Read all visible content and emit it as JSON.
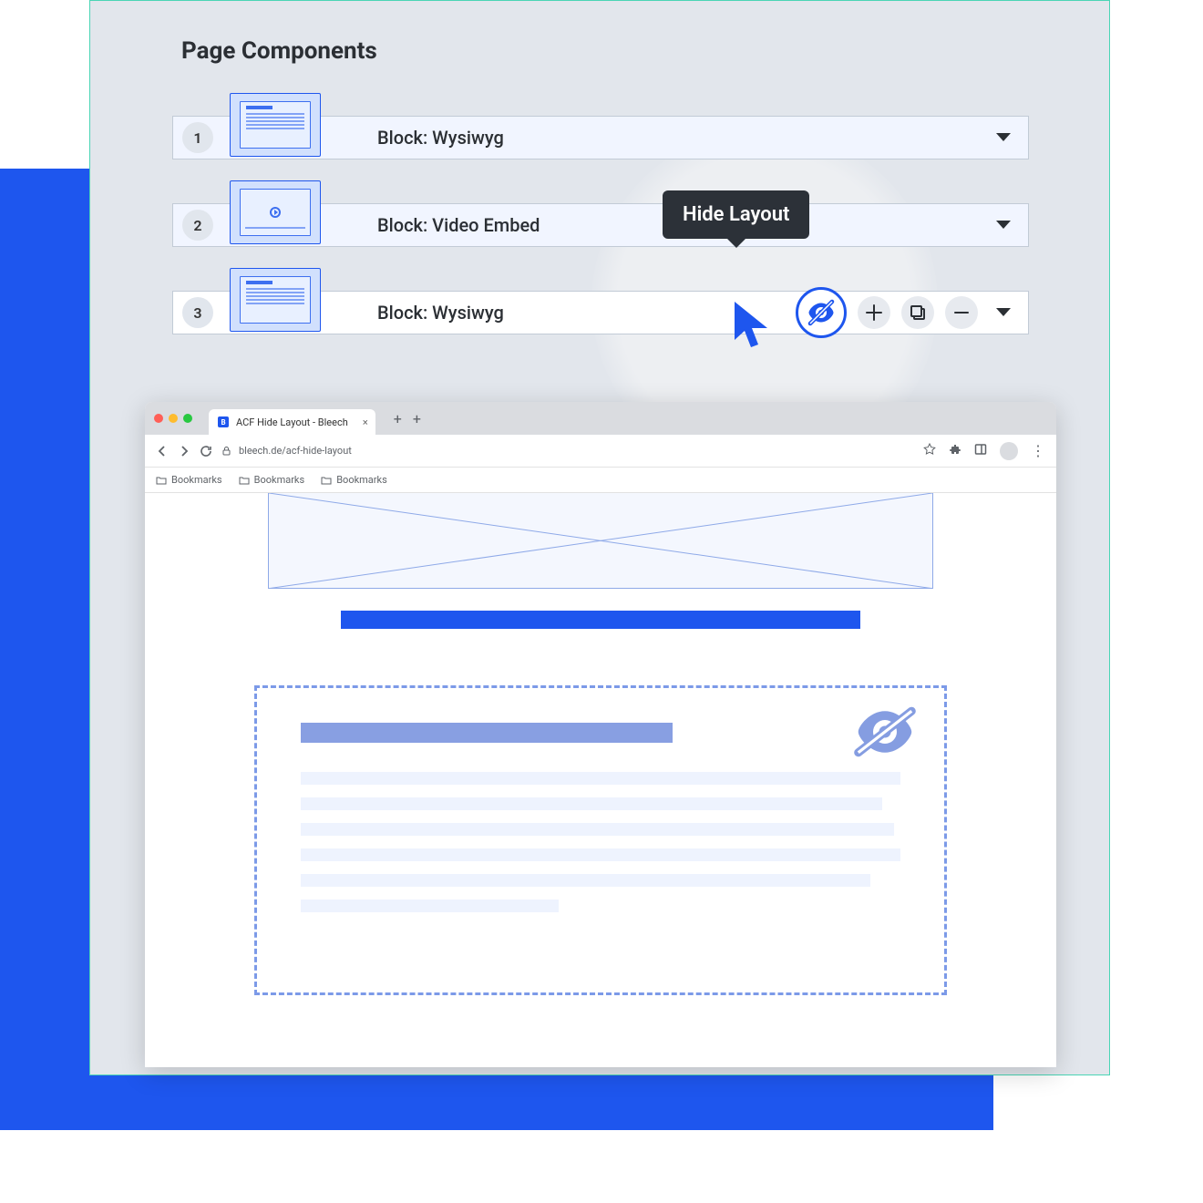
{
  "heading": "Page Components",
  "blocks": [
    {
      "num": "1",
      "label": "Block: Wysiwyg",
      "thumb": "text"
    },
    {
      "num": "2",
      "label": "Block: Video Embed",
      "thumb": "video"
    },
    {
      "num": "3",
      "label": "Block: Wysiwyg",
      "thumb": "text"
    }
  ],
  "tooltip": "Hide Layout",
  "browser": {
    "tab_title": "ACF Hide Layout - Bleech",
    "tab_icon_letter": "B",
    "url": "bleech.de/acf-hide-layout",
    "bookmarks": [
      "Bookmarks",
      "Bookmarks",
      "Bookmarks"
    ],
    "newtab_glyph1": "+",
    "newtab_glyph2": "+",
    "tab_close": "×",
    "menu_dots": "⋮"
  },
  "colors": {
    "accent": "#1E56EE",
    "teal_border": "#4BD5B5",
    "panel_bg": "#E2E6EC"
  }
}
